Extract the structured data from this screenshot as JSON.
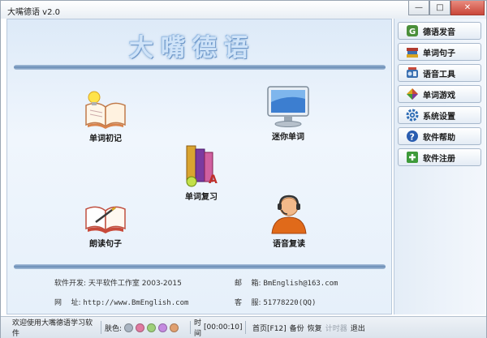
{
  "window": {
    "title": "大嘴德语 v2.0"
  },
  "app_title": "大嘴德语",
  "tiles": [
    {
      "label": "单词初记",
      "icon": "open-book-lightbulb-icon"
    },
    {
      "label": "迷你单词",
      "icon": "monitor-icon"
    },
    {
      "label": "单词复习",
      "icon": "stacked-books-icon"
    },
    {
      "label": "朗读句子",
      "icon": "book-pen-icon"
    },
    {
      "label": "语音复读",
      "icon": "headset-person-icon"
    }
  ],
  "footer": {
    "developer_label": "软件开发:",
    "developer_value": "天平软件工作室 2003-2015",
    "url_label": "网    址:",
    "url_value": "http://www.BmEnglish.com",
    "email_label": "邮    箱:",
    "email_value": "BmEnglish@163.com",
    "service_label": "客    服:",
    "service_value": "51778220(QQ)"
  },
  "sidebar": [
    {
      "label": "德语发音",
      "icon": "g-badge-icon",
      "color": "#4a8f3a"
    },
    {
      "label": "单词句子",
      "icon": "books-icon",
      "color": "#b03a2e"
    },
    {
      "label": "语音工具",
      "icon": "speaker-tools-icon",
      "color": "#3a6fb0"
    },
    {
      "label": "单词游戏",
      "icon": "puzzle-icon",
      "color": "#d9a520"
    },
    {
      "label": "系统设置",
      "icon": "gear-icon",
      "color": "#2f6db5"
    },
    {
      "label": "软件帮助",
      "icon": "help-icon",
      "color": "#2a5db0"
    },
    {
      "label": "软件注册",
      "icon": "register-icon",
      "color": "#3e9a3a"
    }
  ],
  "status": {
    "welcome": "欢迎使用大嘴德语学习软件",
    "skin_label": "肤色:",
    "skin_colors": [
      "#a9b4c1",
      "#e07aa0",
      "#9ed07a",
      "#c48ae0",
      "#e0a070"
    ],
    "time_label": "时间",
    "time_value": "[00:00:10]",
    "home_label": "首页[F12]",
    "backup_label": "备份",
    "restore_label": "恢复",
    "calc_label": "计时器",
    "exit_label": "退出"
  }
}
